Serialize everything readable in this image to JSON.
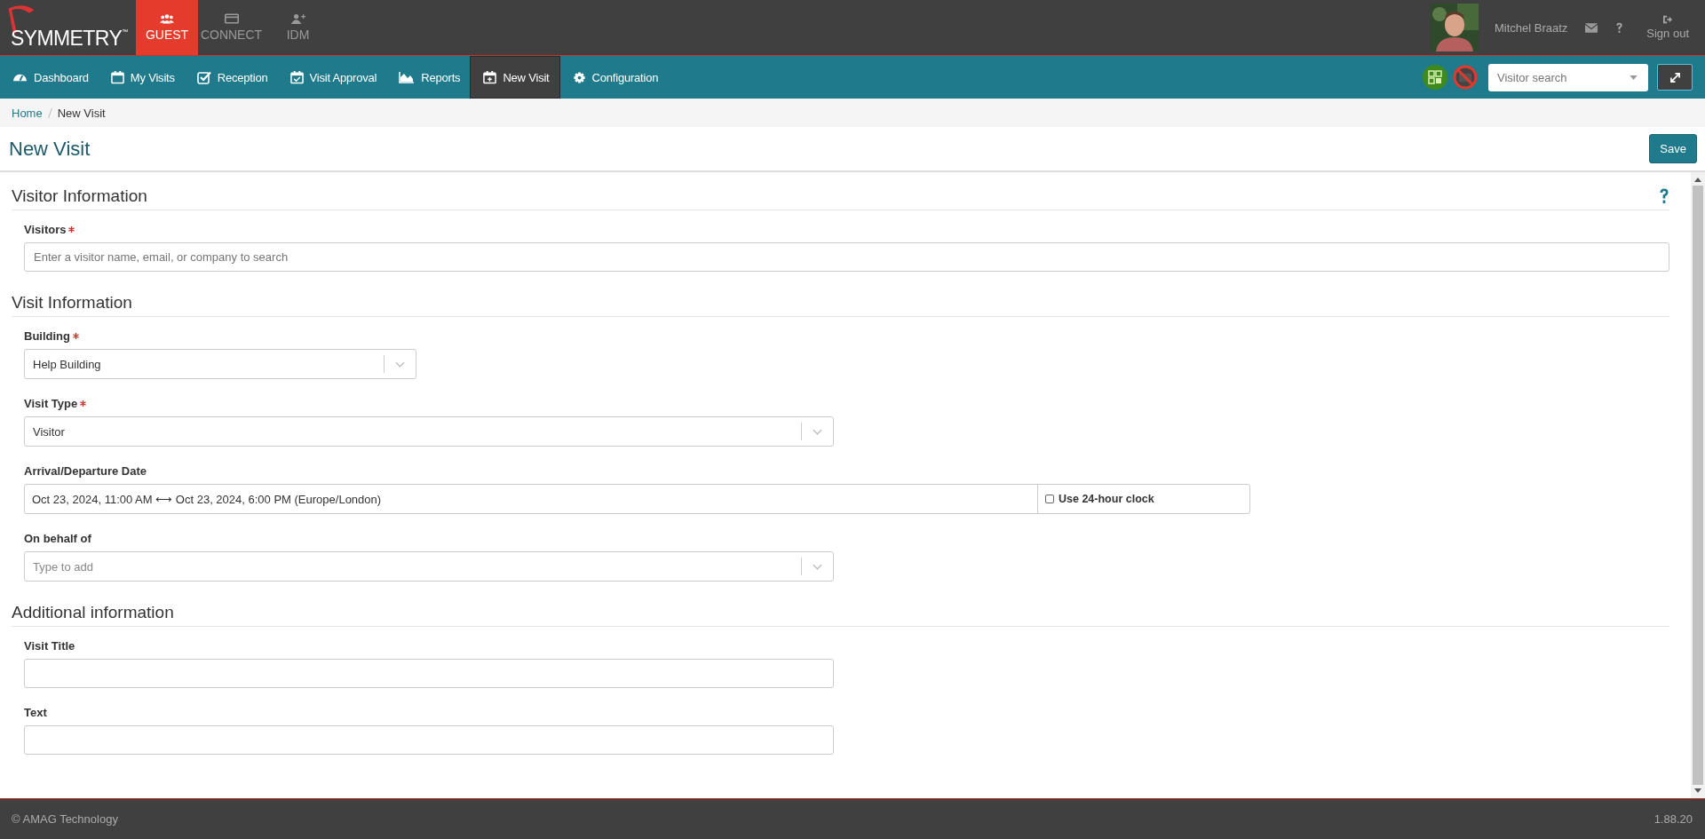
{
  "header": {
    "logo": "SYMMETRY",
    "logo_mark": "™",
    "apps": [
      {
        "label": "GUEST",
        "selected": true
      },
      {
        "label": "CONNECT",
        "selected": false
      },
      {
        "label": "IDM",
        "selected": false
      }
    ],
    "user": "Mitchel Braatz",
    "sign_out": "Sign out"
  },
  "nav": {
    "items": [
      {
        "label": "Dashboard",
        "selected": false
      },
      {
        "label": "My Visits",
        "selected": false
      },
      {
        "label": "Reception",
        "selected": false
      },
      {
        "label": "Visit Approval",
        "selected": false
      },
      {
        "label": "Reports",
        "selected": false
      },
      {
        "label": "New Visit",
        "selected": true
      },
      {
        "label": "Configuration",
        "selected": false
      }
    ],
    "search": {
      "placeholder": "Visitor search"
    }
  },
  "breadcrumb": [
    "Home",
    "New Visit"
  ],
  "page": {
    "title": "New Visit",
    "save": "Save"
  },
  "sections": [
    {
      "title": "Visitor Information",
      "help": true,
      "fields": [
        {
          "label": "Visitors",
          "required": true,
          "kind": "text",
          "placeholder": "Enter a visitor name, email, or company to search"
        }
      ]
    },
    {
      "title": "Visit Information",
      "help": false,
      "fields": [
        {
          "label": "Building",
          "required": true,
          "kind": "select",
          "value": "Help Building"
        },
        {
          "label": "Visit Type",
          "required": true,
          "kind": "select",
          "value": "Visitor"
        },
        {
          "label": "Arrival/Departure Date",
          "required": false,
          "kind": "daterange",
          "value": "Oct 23, 2024, 11:00 AM ⟷ Oct 23, 2024, 6:00 PM (Europe/London)",
          "option": "Use 24-hour clock",
          "checked": false
        },
        {
          "label": "On behalf of",
          "required": false,
          "kind": "select",
          "placeholder": "Type to add"
        }
      ]
    },
    {
      "title": "Additional information",
      "help": false,
      "fields": [
        {
          "label": "Visit Title",
          "required": false,
          "kind": "text"
        },
        {
          "label": "Text",
          "required": false,
          "kind": "text"
        }
      ]
    }
  ],
  "footer": {
    "copyright": "© AMAG Technology",
    "version": "1.88.20"
  }
}
